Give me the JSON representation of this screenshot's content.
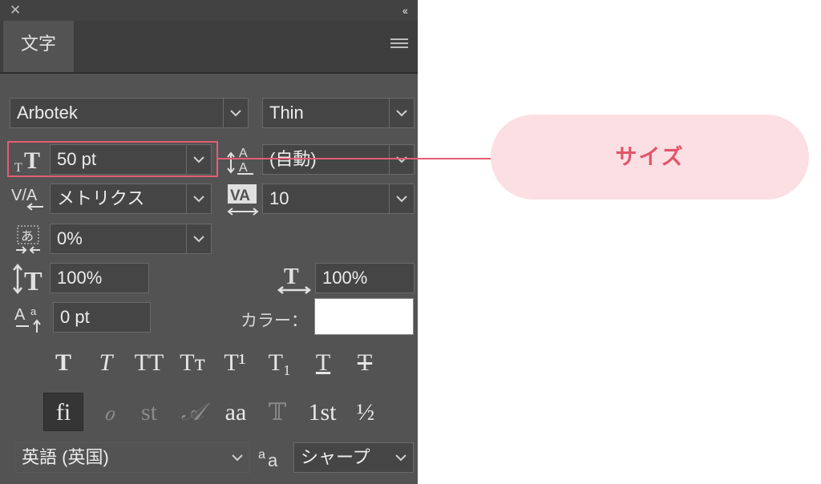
{
  "panel": {
    "close_glyph": "✕",
    "collapse_glyph": "‹‹",
    "tab_label": "文字"
  },
  "font": {
    "family": "Arbotek",
    "style": "Thin"
  },
  "size": {
    "value": "50 pt",
    "icon": "font-size-icon"
  },
  "leading": {
    "value": "(自動)",
    "icon": "leading-icon"
  },
  "kerning": {
    "value": "メトリクス",
    "icon": "kerning-icon"
  },
  "tracking": {
    "value": "10",
    "icon": "tracking-icon"
  },
  "tsume": {
    "value": "0%",
    "icon": "tsume-icon"
  },
  "vertical_scale": {
    "value": "100%",
    "icon": "vertical-scale-icon"
  },
  "horizontal_scale": {
    "value": "100%",
    "icon": "horizontal-scale-icon"
  },
  "baseline_shift": {
    "value": "0 pt",
    "icon": "baseline-shift-icon"
  },
  "color": {
    "label": "カラー：",
    "value": "#ffffff"
  },
  "style_buttons": [
    "T",
    "T",
    "TT",
    "Tт",
    "T¹",
    "T₁",
    "T",
    "T"
  ],
  "opentype_buttons": [
    "fi",
    "ℴ",
    "st",
    "𝒜",
    "aa",
    "𝕋",
    "1st",
    "½"
  ],
  "language": {
    "value": "英語 (英国)"
  },
  "antialias": {
    "value": "シャープ",
    "icon": "antialias-icon"
  },
  "annotation": {
    "label": "サイズ",
    "color": "#e35e73",
    "fill": "#fcdfe3"
  }
}
